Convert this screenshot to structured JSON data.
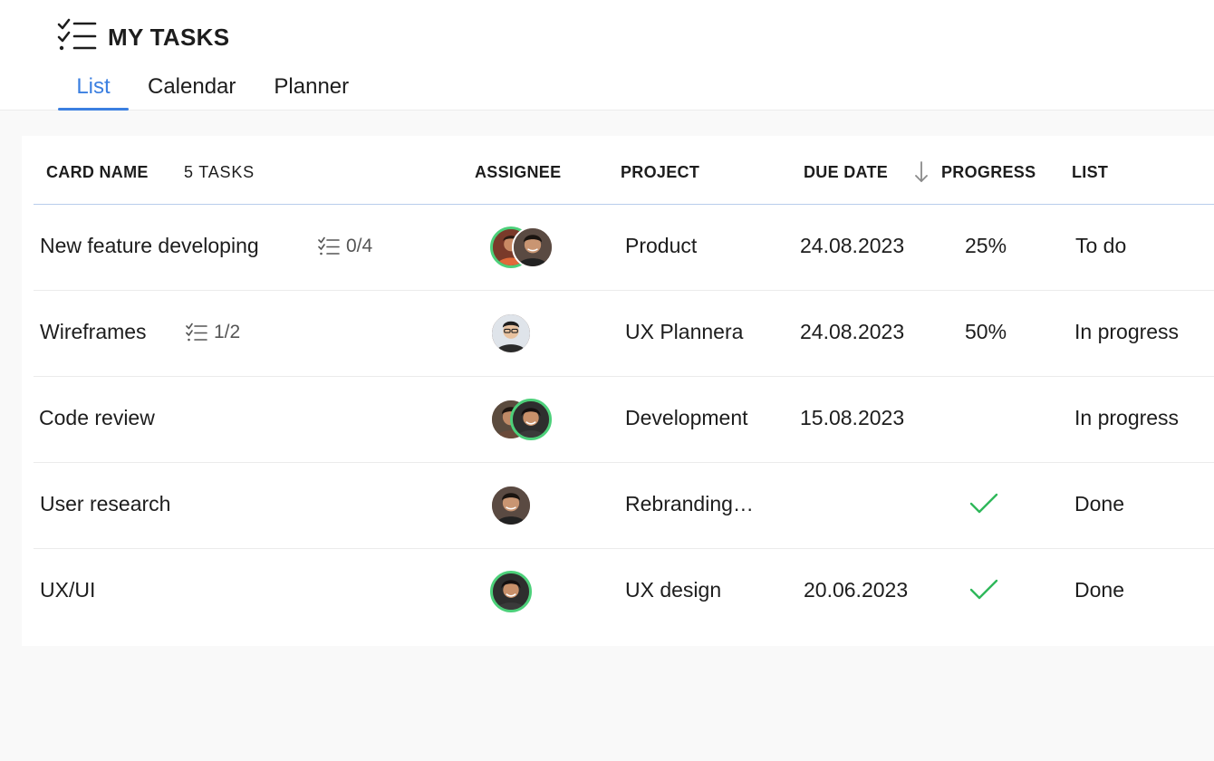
{
  "app": {
    "title": "MY TASKS",
    "icon": "checklist-icon"
  },
  "tabs": [
    {
      "label": "List",
      "active": true
    },
    {
      "label": "Calendar",
      "active": false
    },
    {
      "label": "Planner",
      "active": false
    }
  ],
  "table": {
    "headers": {
      "card_name": "CARD NAME",
      "task_count": "5 TASKS",
      "assignee": "ASSIGNEE",
      "project": "PROJECT",
      "due_date": "DUE DATE",
      "progress": "PROGRESS",
      "list": "LIST"
    },
    "sort": {
      "column": "due_date",
      "direction": "descending",
      "icon": "arrow-down-icon"
    },
    "rows": [
      {
        "name": "New feature developing",
        "checklist": "0/4",
        "project": "Product",
        "due": "24.08.2023",
        "progress": "25%",
        "progress_done": false,
        "list": "To do"
      },
      {
        "name": "Wireframes",
        "checklist": "1/2",
        "project": "UX Plannera",
        "due": "24.08.2023",
        "progress": "50%",
        "progress_done": false,
        "list": "In progress"
      },
      {
        "name": "Code review",
        "checklist": "",
        "project": "Development",
        "due": "15.08.2023",
        "progress": "",
        "progress_done": false,
        "list": "In progress"
      },
      {
        "name": "User research",
        "checklist": "",
        "project": "Rebranding…",
        "due": "",
        "progress": "",
        "progress_done": true,
        "list": "Done"
      },
      {
        "name": "UX/UI",
        "checklist": "",
        "project": "UX design",
        "due": "20.06.2023",
        "progress": "",
        "progress_done": true,
        "list": "Done"
      }
    ]
  },
  "colors": {
    "accent": "#3b7fe0",
    "success": "#2fb85a",
    "avatar_ring": "#4cd07a",
    "divider": "#ebebeb",
    "header_border": "#b8cdec"
  }
}
